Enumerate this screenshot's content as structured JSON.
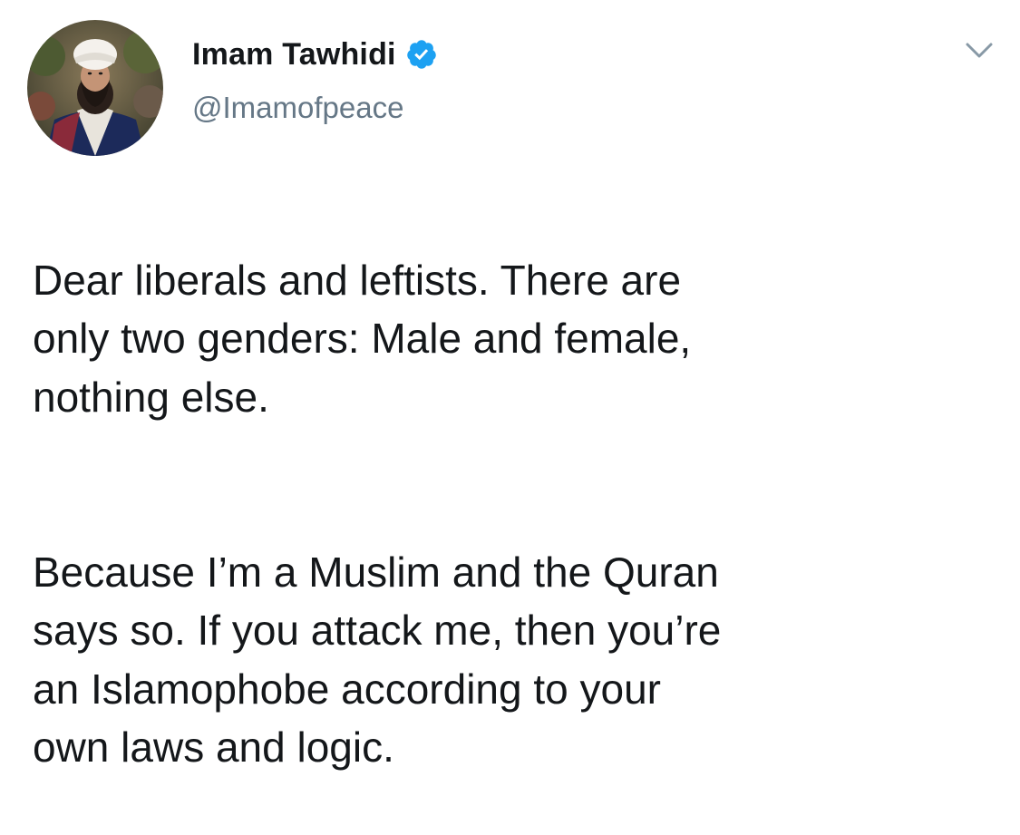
{
  "tweet": {
    "author": {
      "display_name": "Imam Tawhidi",
      "handle": "@Imamofpeace",
      "verified": true,
      "verified_icon": "verified-badge-icon"
    },
    "menu_icon": "chevron-down-icon",
    "paragraphs": [
      "Dear liberals and leftists. There are\nonly two genders: Male and female,\nnothing else.",
      "Because I’m a Muslim and the Quran\nsays so. If you attack me, then you’re\nan Islamophobe according to your\nown  laws and logic."
    ]
  },
  "colors": {
    "text": "#14171a",
    "secondary_text": "#657786",
    "verified_blue": "#1da1f2",
    "background": "#ffffff"
  }
}
